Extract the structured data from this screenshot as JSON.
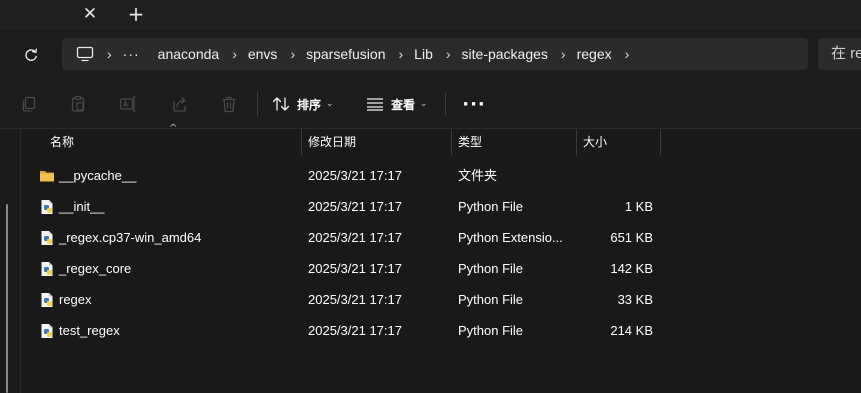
{
  "tabs": {
    "close_glyph": "✕",
    "new_tab_glyph": "+"
  },
  "address": {
    "more": "···",
    "separator": "›",
    "crumbs": [
      "anaconda",
      "envs",
      "sparsefusion",
      "Lib",
      "site-packages",
      "regex"
    ],
    "search_placeholder": "在 re"
  },
  "commandbar": {
    "sort_label": "排序",
    "view_label": "查看",
    "more_label": "···",
    "icons": [
      "copy-icon",
      "paste-icon",
      "rename-icon",
      "share-icon",
      "delete-icon"
    ]
  },
  "columns": {
    "name": "名称",
    "modified": "修改日期",
    "type": "类型",
    "size": "大小"
  },
  "files": [
    {
      "name": "__pycache__",
      "modified": "2025/3/21 17:17",
      "type": "文件夹",
      "size": "",
      "icon": "folder-icon"
    },
    {
      "name": "__init__",
      "modified": "2025/3/21 17:17",
      "type": "Python File",
      "size": "1 KB",
      "icon": "python-file-icon"
    },
    {
      "name": "_regex.cp37-win_amd64",
      "modified": "2025/3/21 17:17",
      "type": "Python Extensio...",
      "size": "651 KB",
      "icon": "python-extension-icon"
    },
    {
      "name": "_regex_core",
      "modified": "2025/3/21 17:17",
      "type": "Python File",
      "size": "142 KB",
      "icon": "python-file-icon"
    },
    {
      "name": "regex",
      "modified": "2025/3/21 17:17",
      "type": "Python File",
      "size": "33 KB",
      "icon": "python-file-icon"
    },
    {
      "name": "test_regex",
      "modified": "2025/3/21 17:17",
      "type": "Python File",
      "size": "214 KB",
      "icon": "python-file-icon"
    }
  ],
  "colors": {
    "background": "#191919",
    "folder": "#f2c14e",
    "python_blue": "#3b78b8",
    "python_yellow": "#f5d44a"
  }
}
